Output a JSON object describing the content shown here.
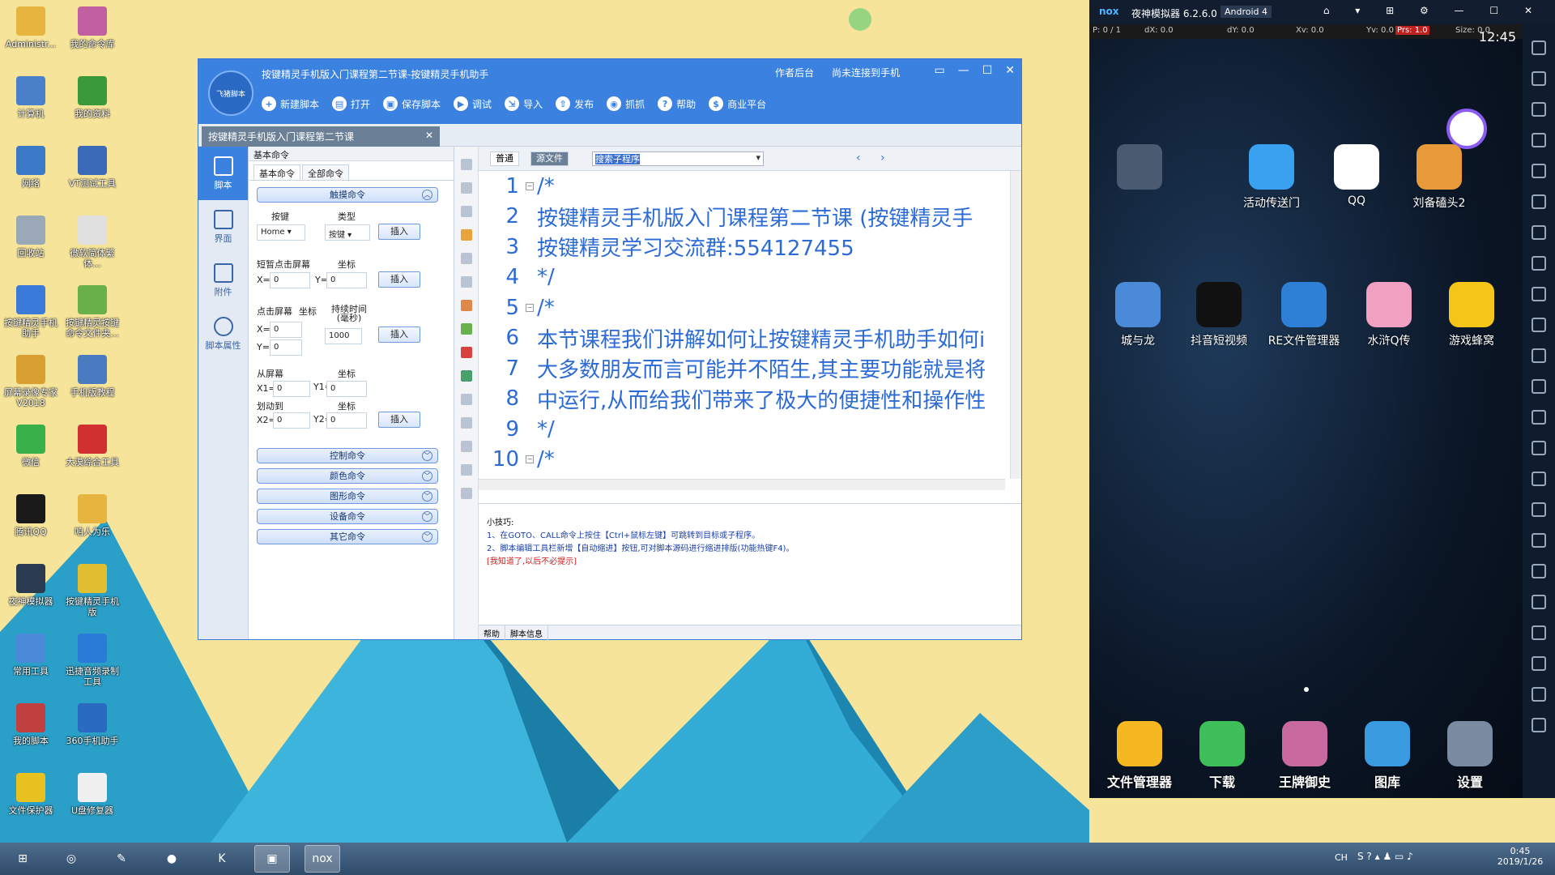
{
  "desktop": {
    "icons": [
      {
        "label": "Administr...",
        "icon": "user-folder-icon"
      },
      {
        "label": "我的命令库",
        "icon": "library-icon"
      },
      {
        "label": "计算机",
        "icon": "computer-icon"
      },
      {
        "label": "我的资料",
        "icon": "tree-icon"
      },
      {
        "label": "网络",
        "icon": "network-icon"
      },
      {
        "label": "VT测试工具",
        "icon": "cpu-icon"
      },
      {
        "label": "回收站",
        "icon": "recycle-bin-icon"
      },
      {
        "label": "微软简体繁体...",
        "icon": "text-icon"
      },
      {
        "label": "按键精灵手机助手",
        "icon": "app-icon"
      },
      {
        "label": "按键精灵按键命令文件夹...",
        "icon": "file-icon"
      },
      {
        "label": "屏幕录像专家V2018",
        "icon": "recorder-icon"
      },
      {
        "label": "手机版教程",
        "icon": "book-icon"
      },
      {
        "label": "微信",
        "icon": "wechat-icon"
      },
      {
        "label": "大漠综合工具",
        "icon": "dm-icon"
      },
      {
        "label": "腾讯QQ",
        "icon": "qq-icon"
      },
      {
        "label": "咱人为乐",
        "icon": "folder-icon"
      },
      {
        "label": "夜神模拟器",
        "icon": "nox-icon"
      },
      {
        "label": "按键精灵手机版",
        "icon": "help-icon"
      },
      {
        "label": "常用工具",
        "icon": "tools-icon"
      },
      {
        "label": "迅捷音频录制工具",
        "icon": "audio-icon"
      },
      {
        "label": "我的脚本",
        "icon": "script-icon"
      },
      {
        "label": "360手机助手",
        "icon": "phone-icon"
      },
      {
        "label": "文件保护器",
        "icon": "shield-icon"
      },
      {
        "label": "U盘修复器",
        "icon": "usb-icon"
      }
    ]
  },
  "window": {
    "title": "按键精灵手机版入门课程第二节课-按键精灵手机助手",
    "logo_label": "飞猪脚本",
    "links": [
      "作者后台",
      "尚未连接到手机"
    ],
    "toolbar": [
      "新建脚本",
      "打开",
      "保存脚本",
      "调试",
      "导入",
      "发布",
      "抓抓",
      "帮助",
      "商业平台"
    ],
    "doc_tab": "按键精灵手机版入门课程第二节课",
    "vnav": [
      "脚本",
      "界面",
      "附件",
      "脚本属性"
    ],
    "panel": {
      "header": "基本命令",
      "tabs": [
        "基本命令",
        "全部命令"
      ],
      "touch_group": "触摸命令",
      "key_label": "按键",
      "type_label": "类型",
      "key_value": "Home",
      "type_value": "按键",
      "tap_title": "短暂点击屏幕",
      "coord": "坐标",
      "x_label": "X=",
      "y_label": "Y=",
      "zero": "0",
      "press_title": "点击屏幕",
      "duration_label": "持续时间\n(毫秒)",
      "duration_value": "1000",
      "from_title": "从屏幕",
      "x1": "X1=",
      "y1": "Y1=",
      "to_title": "划动到",
      "x2": "X2=",
      "y2": "Y2=",
      "insert": "插入",
      "groups": [
        "控制命令",
        "颜色命令",
        "图形命令",
        "设备命令",
        "其它命令"
      ]
    },
    "editor": {
      "mode_normal": "普通",
      "mode_source": "源文件",
      "search_placeholder": "搜索子程序",
      "lines": [
        {
          "n": "1",
          "t": "/*",
          "fold": true
        },
        {
          "n": "2",
          "t": "按键精灵手机版入门课程第二节课 (按键精灵手",
          "fold": false
        },
        {
          "n": "3",
          "t": "按键精灵学习交流群:554127455",
          "fold": false
        },
        {
          "n": "4",
          "t": "*/",
          "fold": false
        },
        {
          "n": "5",
          "t": "/*",
          "fold": true
        },
        {
          "n": "6",
          "t": "本节课程我们讲解如何让按键精灵手机助手如何i",
          "fold": false
        },
        {
          "n": "7",
          "t": "大多数朋友而言可能并不陌生,其主要功能就是将",
          "fold": false
        },
        {
          "n": "8",
          "t": "中运行,从而给我们带来了极大的便捷性和操作性",
          "fold": false
        },
        {
          "n": "9",
          "t": "*/",
          "fold": false
        },
        {
          "n": "10",
          "t": "/*",
          "fold": true
        }
      ]
    },
    "tips": {
      "title": "小技巧:",
      "line1": "1、在GOTO、CALL命令上按住【Ctrl+鼠标左键】可跳转到目标或子程序。",
      "line2": "2、脚本编辑工具栏新增【自动缩进】按钮,可对脚本源码进行缩进排版(功能热键F4)。",
      "line3": "[我知道了,以后不必提示]"
    },
    "bottom_tabs": [
      "帮助",
      "脚本信息"
    ]
  },
  "emulator": {
    "title": "夜神模拟器 6.2.6.0",
    "android": "Android 4",
    "status": {
      "p": "P: 0 / 1",
      "dx": "dX: 0.0",
      "dy": "dY: 0.0",
      "xv": "Xv: 0.0",
      "yv": "Yv: 0.0",
      "prs": "Prs: 1.0",
      "size": "Size: 0.0",
      "time": "12:45"
    },
    "apps": [
      {
        "label": "活动传送门",
        "color": "#3aa0f0"
      },
      {
        "label": "QQ",
        "color": "#ffffff"
      },
      {
        "label": "刘备磕头2",
        "color": "#e89a3a"
      },
      {
        "label": "城与龙",
        "color": "#4a8ad8"
      },
      {
        "label": "抖音短视频",
        "color": "#111111"
      },
      {
        "label": "RE文件管理器",
        "color": "#2e7fd6"
      },
      {
        "label": "水浒Q传",
        "color": "#f0a0c0"
      },
      {
        "label": "游戏蜂窝",
        "color": "#f5c518"
      }
    ],
    "dock": [
      {
        "label": "文件管理器",
        "color": "#f5b820"
      },
      {
        "label": "下载",
        "color": "#3fbf5a"
      },
      {
        "label": "王牌御史",
        "color": "#c86aa0"
      },
      {
        "label": "图库",
        "color": "#3a9be0"
      },
      {
        "label": "设置",
        "color": "#7a8aa0"
      }
    ]
  },
  "taskbar": {
    "clock_time": "0:45",
    "clock_date": "2019/1/26",
    "lang": "CH"
  }
}
